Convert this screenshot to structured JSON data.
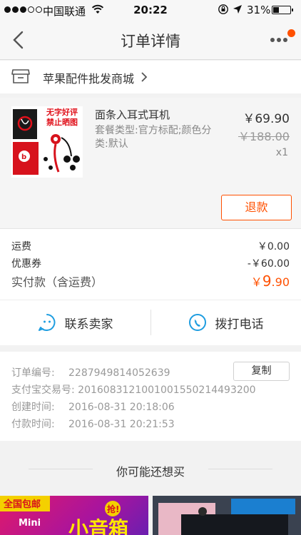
{
  "status_bar": {
    "carrier": "中国联通",
    "time": "20:22",
    "battery_pct": "31%",
    "battery_level": 0.31,
    "icons": [
      "signal-dots",
      "wifi-icon",
      "rotation-lock-icon",
      "location-arrow-icon",
      "battery-icon"
    ]
  },
  "nav": {
    "title": "订单详情",
    "back_icon": "chevron-left-icon",
    "more_icon": "more-dots-icon",
    "accent": "#ff5000"
  },
  "shop": {
    "name": "苹果配件批发商城",
    "icon": "store-icon"
  },
  "product": {
    "thumb_text": "无字好评 禁止晒图",
    "name": "面条入耳式耳机",
    "spec": "套餐类型:官方标配;颜色分类:默认",
    "price": "￥69.90",
    "original_price": "￥188.00",
    "quantity": "x1",
    "refund_label": "退款"
  },
  "fees": {
    "shipping_label": "运费",
    "shipping_value": "￥0.00",
    "coupon_label": "优惠券",
    "coupon_value": "-￥60.00",
    "total_label": "实付款（含运费）",
    "total_currency": "￥",
    "total_int": "9",
    "total_dec": ".90"
  },
  "contact": {
    "seller_label": "联系卖家",
    "call_label": "拨打电话",
    "accent": "#1e9de0"
  },
  "order_info": {
    "order_no_label": "订单编号:",
    "order_no": "2287949814052639",
    "copy_label": "复制",
    "alipay_label": "支付宝交易号:",
    "alipay_no": "2016083121001001550214493200",
    "created_label": "创建时间:",
    "created": "2016-08-31 20:18:06",
    "paid_label": "付款时间:",
    "paid": "2016-08-31 20:21:53"
  },
  "recommend": {
    "title": "你可能还想买",
    "card1_text": "全国包邮",
    "card1_badge": "抢!",
    "card1_sub": "Mini",
    "card1_big": "小音箱"
  }
}
